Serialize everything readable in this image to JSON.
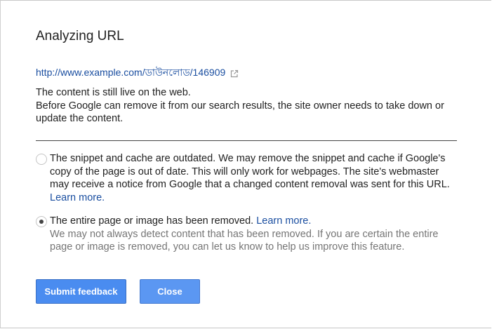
{
  "dialog": {
    "title": "Analyzing URL",
    "url": "http://www.example.com/ডাউনলোড/146909",
    "status_line1": "The content is still live on the web.",
    "status_line2": "Before Google can remove it from our search results, the site owner needs to take down or update the content."
  },
  "options": [
    {
      "text": "The snippet and cache are outdated. We may remove the snippet and cache if Google's copy of the page is out of date. This will only work for webpages. The site's webmaster may receive a notice from Google that a changed content removal was sent for this URL.",
      "link": "Learn more.",
      "selected": false
    },
    {
      "text": "The entire page or image has been removed.",
      "link": "Learn more.",
      "subtext": "We may not always detect content that has been removed. If you are certain the entire page or image is removed, you can let us know to help us improve this feature.",
      "selected": true
    }
  ],
  "buttons": {
    "submit": "Submit feedback",
    "close": "Close"
  },
  "icons": {
    "external": "external-link-icon",
    "radio": "radio-button-icon"
  },
  "colors": {
    "link": "#1a4ea0",
    "button": "#4a8cf0",
    "subtext": "#757575"
  }
}
